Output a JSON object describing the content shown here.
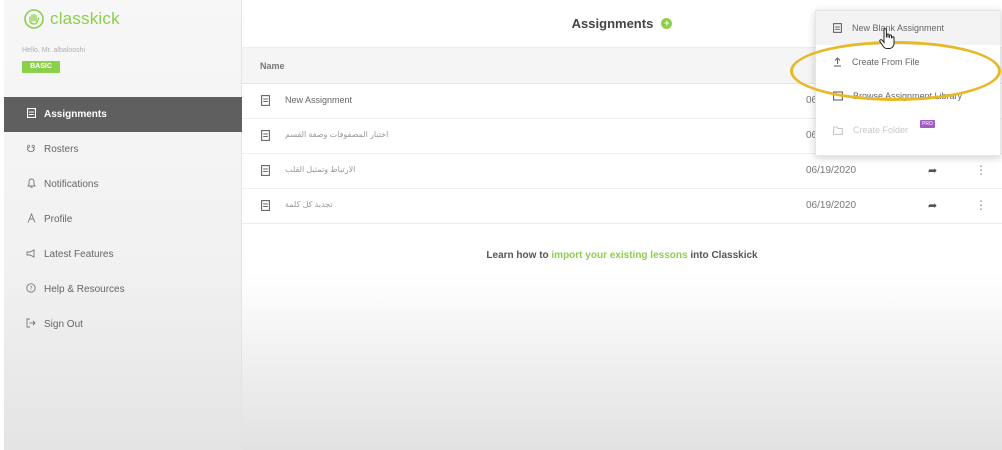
{
  "brand": {
    "name": "classkick",
    "accent_color": "#8bd04a"
  },
  "user": {
    "greeting": "Hello, Mr. albalooshi",
    "plan_badge": "BASIC"
  },
  "sidebar": {
    "items": [
      {
        "label": "Assignments",
        "icon": "document-icon",
        "active": true
      },
      {
        "label": "Rosters",
        "icon": "rosters-icon"
      },
      {
        "label": "Notifications",
        "icon": "bell-icon"
      },
      {
        "label": "Profile",
        "icon": "person-icon"
      },
      {
        "label": "Latest Features",
        "icon": "megaphone-icon"
      },
      {
        "label": "Help & Resources",
        "icon": "help-icon"
      },
      {
        "label": "Sign Out",
        "icon": "sign-out-icon"
      }
    ]
  },
  "main": {
    "title": "Assignments",
    "table": {
      "columns": [
        "Name"
      ],
      "rows": [
        {
          "name": "New Assignment",
          "date": "06/19/2020"
        },
        {
          "name": "اختبار المصفوفات وصفة القسم",
          "date": "06/19/2020"
        },
        {
          "name": "الارتباط وتمثيل القلب",
          "date": "06/19/2020"
        },
        {
          "name": "تجديد كل كلمة",
          "date": "06/19/2020"
        }
      ]
    },
    "learn": {
      "prefix": "Learn how to ",
      "link": "import your existing lessons",
      "suffix": " into Classkick"
    }
  },
  "dropdown": {
    "items": [
      {
        "label": "New Blank Assignment",
        "icon": "document-icon"
      },
      {
        "label": "Create From File",
        "icon": "upload-icon"
      },
      {
        "label": "Browse Assignment Library",
        "icon": "library-icon"
      },
      {
        "label": "Create Folder",
        "icon": "folder-icon",
        "disabled": true,
        "badge": "PRO"
      }
    ]
  },
  "annotation": {
    "highlight_color": "#e7b928"
  }
}
